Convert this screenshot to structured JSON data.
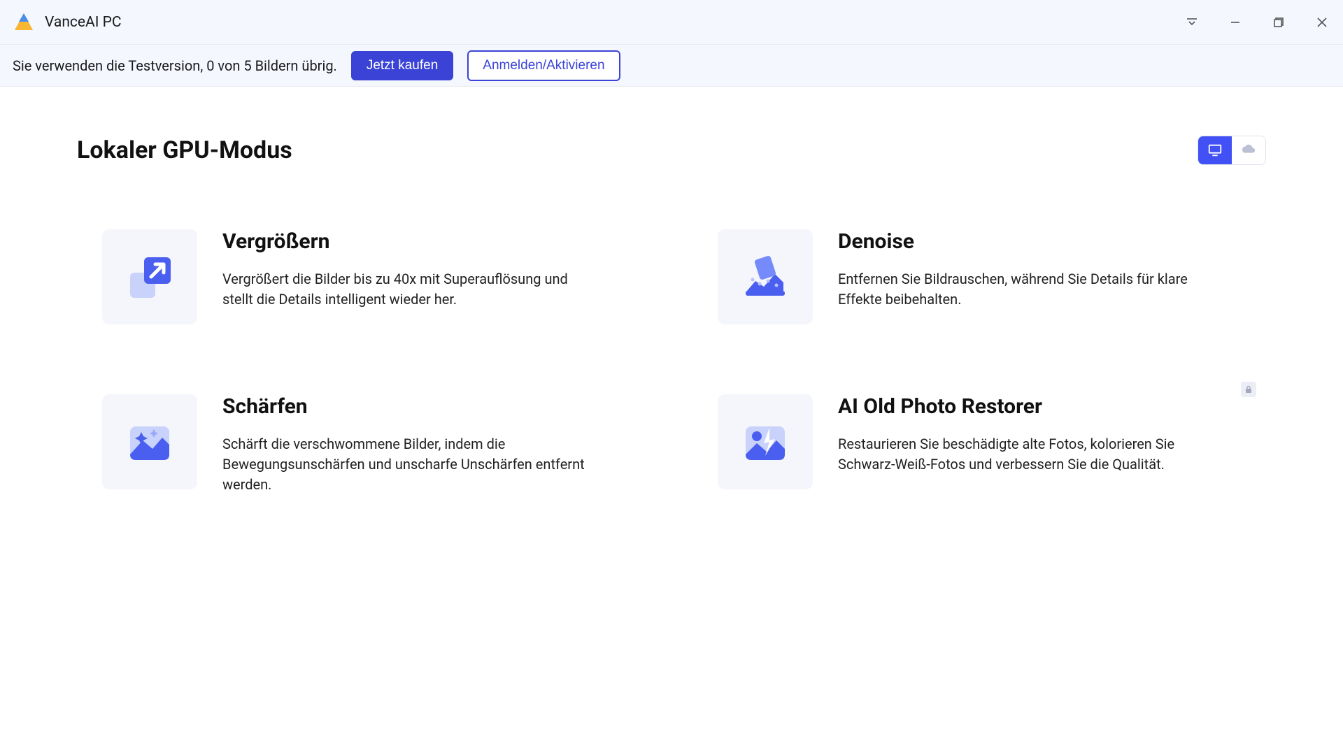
{
  "app": {
    "title": "VanceAI PC"
  },
  "trial": {
    "message": "Sie verwenden die Testversion, 0 von 5 Bildern übrig.",
    "buy_label": "Jetzt kaufen",
    "login_label": "Anmelden/Aktivieren"
  },
  "page": {
    "title": "Lokaler GPU-Modus"
  },
  "features": [
    {
      "title": "Vergrößern",
      "desc": "Vergrößert die Bilder bis zu 40x mit Superauflösung und stellt die Details intelligent wieder her."
    },
    {
      "title": "Denoise",
      "desc": "Entfernen Sie Bildrauschen, während Sie Details für klare Effekte beibehalten."
    },
    {
      "title": "Schärfen",
      "desc": "Schärft die verschwommene Bilder, indem die Bewegungsunschärfen und unscharfe Unschärfen entfernt werden."
    },
    {
      "title": "AI Old Photo Restorer",
      "desc": "Restaurieren Sie beschädigte alte Fotos, kolorieren Sie Schwarz-Weiß-Fotos und verbessern Sie die Qualität."
    }
  ]
}
